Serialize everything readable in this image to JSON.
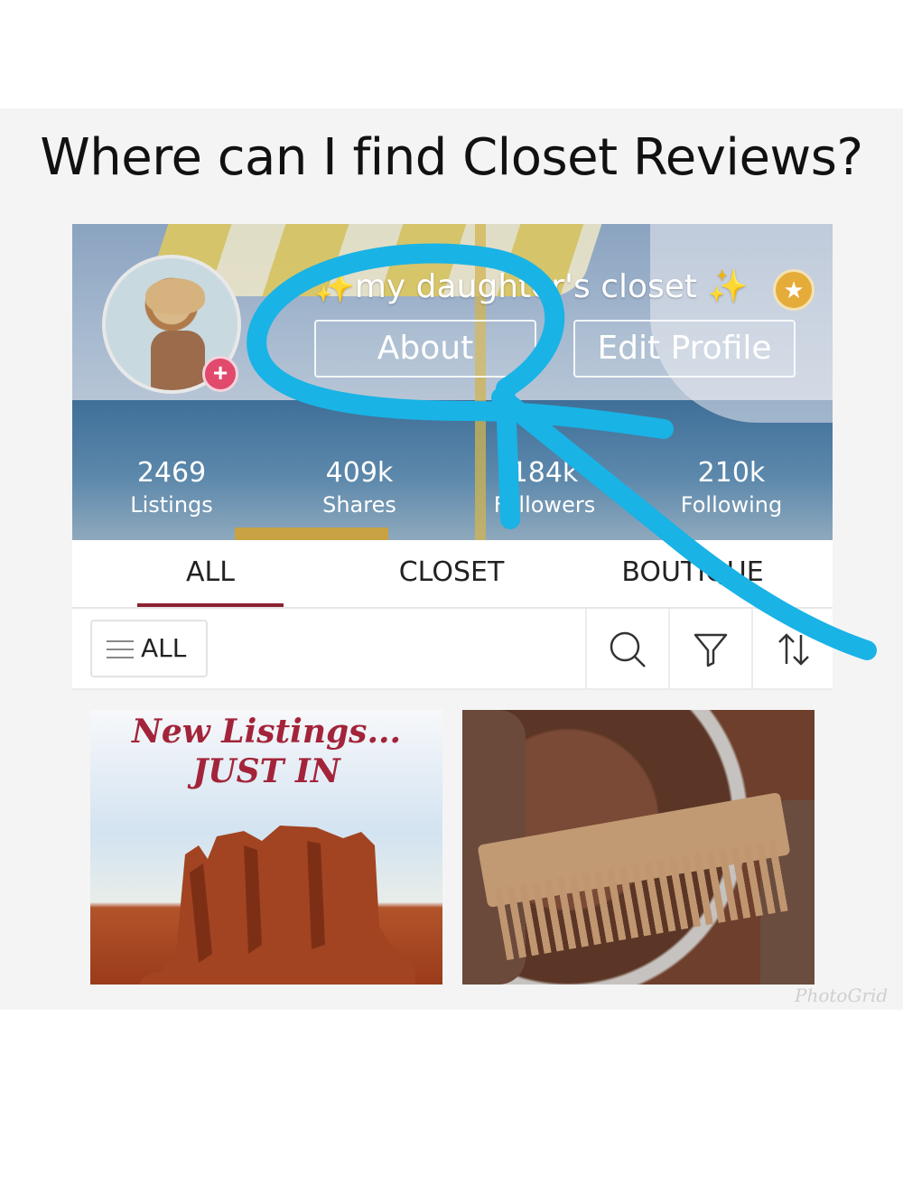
{
  "question": "Where can I find Closet Reviews?",
  "profile": {
    "closet_name": "✨my daughter's closet ✨",
    "about_label": "About",
    "edit_profile_label": "Edit Profile",
    "stats": [
      {
        "value": "2469",
        "label": "Listings"
      },
      {
        "value": "409k",
        "label": "Shares"
      },
      {
        "value": "184k",
        "label": "Followers"
      },
      {
        "value": "210k",
        "label": "Following"
      }
    ]
  },
  "tabs": [
    "ALL",
    "CLOSET",
    "BOUTIQUE"
  ],
  "active_tab": "ALL",
  "filter": {
    "label": "ALL"
  },
  "listings": [
    {
      "title_line1": "New Listings...",
      "title_line2": "JUST IN"
    }
  ],
  "watermark": "PhotoGrid",
  "colors": {
    "annotation": "#19b3e6",
    "accent": "#8b2232",
    "badge_pink": "#e14a6d",
    "badge_gold": "#e6ac3a"
  },
  "icons": [
    "add-icon",
    "star-icon",
    "menu-icon",
    "search-icon",
    "filter-icon",
    "sort-icon"
  ]
}
